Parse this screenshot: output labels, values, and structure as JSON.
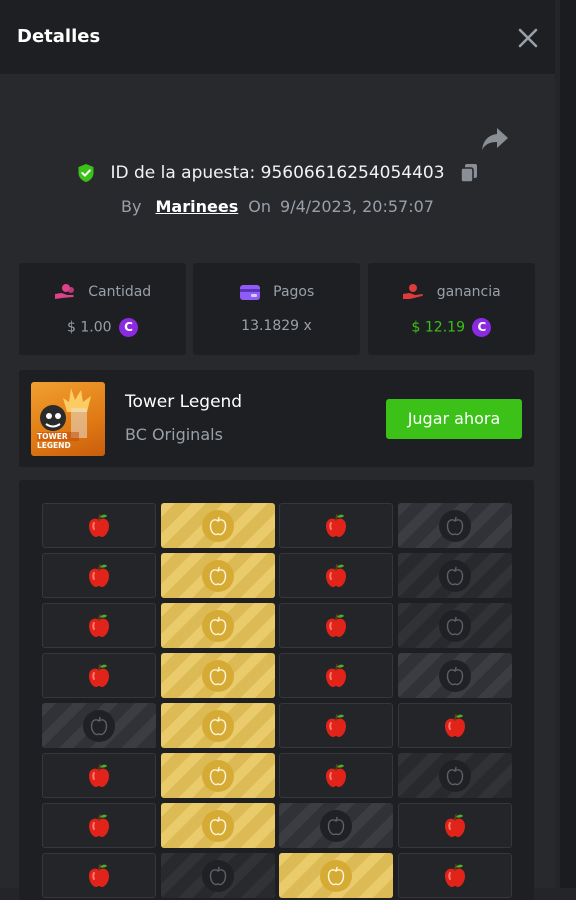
{
  "header": {
    "title": "Detalles"
  },
  "bet": {
    "id_label": "ID de la apuesta: 95606616254054403",
    "by_label": "By",
    "username": "Marinees",
    "on_label": "On",
    "datetime": "9/4/2023, 20:57:07"
  },
  "stats": [
    {
      "label": "Cantidad",
      "value": "$ 1.00",
      "icon": "coins-hand-icon",
      "color": "#e0418a"
    },
    {
      "label": "Pagos",
      "value": "13.1829 x",
      "icon": "wallet-icon",
      "color": "#8f5cf6"
    },
    {
      "label": "ganancia",
      "value": "$ 12.19",
      "icon": "profit-hand-icon",
      "color": "#e03b3b",
      "value_color": "#3bc117"
    }
  ],
  "coin_symbol": "C",
  "game": {
    "name": "Tower Legend",
    "provider": "BC Originals",
    "play_label": "Jugar ahora",
    "thumb_text": "TOWER LEGEND"
  },
  "colors": {
    "accent_green": "#3bc117",
    "shield_green": "#3bc117",
    "gold_tile": "#e8c55a",
    "apple_red": "#e2231a"
  },
  "board": {
    "rows": [
      [
        "apple",
        "gold",
        "apple",
        "dark"
      ],
      [
        "apple",
        "gold",
        "apple",
        "dim"
      ],
      [
        "apple",
        "gold",
        "apple",
        "dim"
      ],
      [
        "apple",
        "gold",
        "apple",
        "dark"
      ],
      [
        "dark",
        "gold",
        "apple",
        "apple"
      ],
      [
        "apple",
        "gold",
        "apple",
        "dim"
      ],
      [
        "apple",
        "gold",
        "dark",
        "apple"
      ],
      [
        "apple",
        "dim",
        "gold",
        "apple"
      ]
    ]
  }
}
